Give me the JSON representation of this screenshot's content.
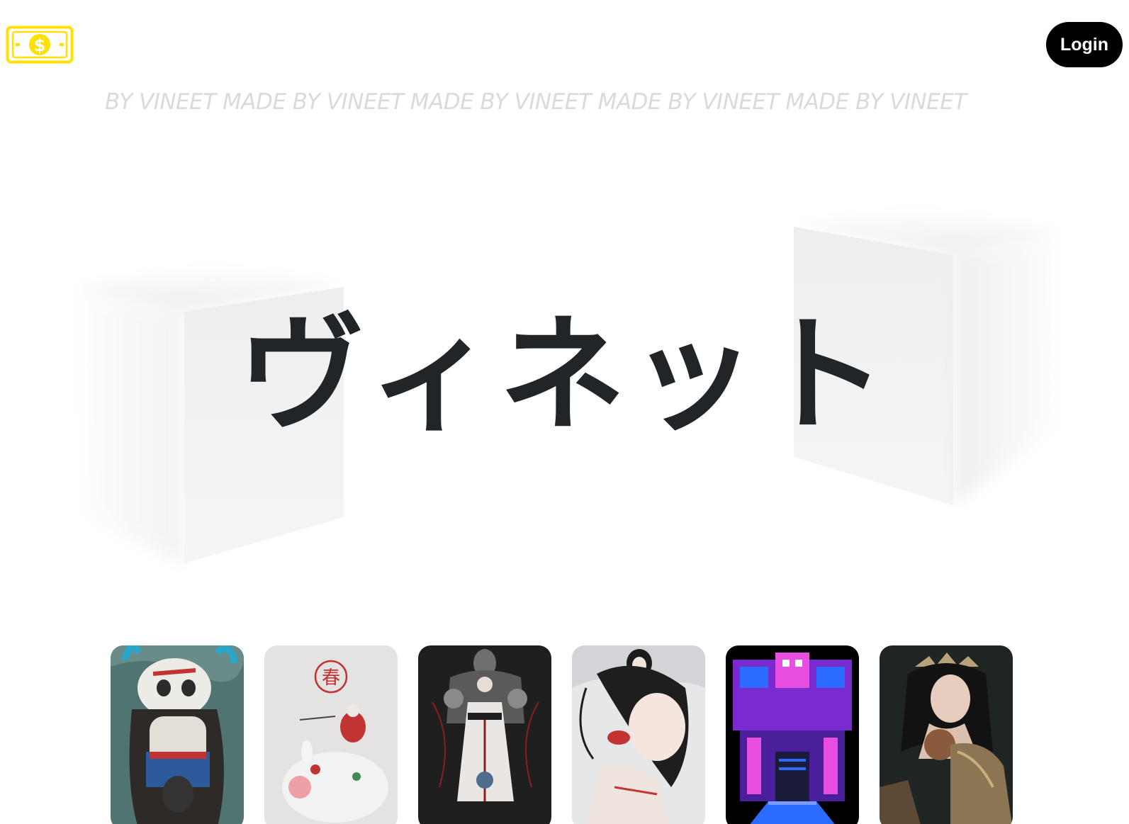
{
  "header": {
    "logo_icon": "money-bill-icon",
    "logo_color": "#FFE000",
    "login_label": "Login"
  },
  "marquee": {
    "text": "BY VINEET MADE BY VINEET MADE BY VINEET MADE BY VINEET MADE BY VINEET"
  },
  "hero": {
    "title": "ヴィネット"
  },
  "gallery": {
    "cards": [
      {
        "name": "artwork-card-mask-girl"
      },
      {
        "name": "artwork-card-spring-pig"
      },
      {
        "name": "artwork-card-armored-giant"
      },
      {
        "name": "artwork-card-geisha"
      },
      {
        "name": "artwork-card-pixel-temple"
      },
      {
        "name": "artwork-card-crowned-lady"
      }
    ],
    "spring_glyph": "春"
  },
  "colors": {
    "accent": "#FFE000",
    "button_bg": "#000000",
    "title": "#222528",
    "marquee": "#D9DADC"
  }
}
